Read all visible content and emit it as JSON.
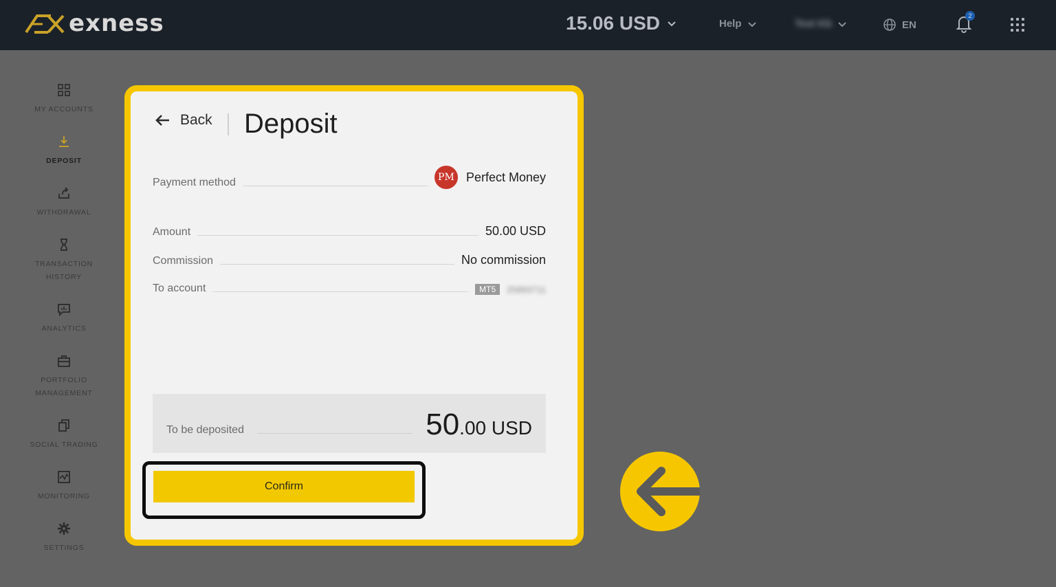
{
  "header": {
    "logo_text": "exness",
    "balance": "15.06 USD",
    "help_label": "Help",
    "user_label": "Test Kb",
    "language": "EN",
    "notification_count": "2"
  },
  "sidebar": {
    "items": [
      {
        "label": "MY ACCOUNTS",
        "icon": "grid-icon"
      },
      {
        "label": "DEPOSIT",
        "icon": "download-icon"
      },
      {
        "label": "WITHDRAWAL",
        "icon": "upload-icon"
      },
      {
        "label": "TRANSACTION HISTORY",
        "icon": "hourglass-icon"
      },
      {
        "label": "ANALYTICS",
        "icon": "chat-chart-icon"
      },
      {
        "label": "PORTFOLIO MANAGEMENT",
        "icon": "briefcase-icon"
      },
      {
        "label": "SOCIAL TRADING",
        "icon": "copy-icon"
      },
      {
        "label": "MONITORING",
        "icon": "monitor-chart-icon"
      },
      {
        "label": "SETTINGS",
        "icon": "gear-icon"
      }
    ]
  },
  "deposit": {
    "back_label": "Back",
    "title": "Deposit",
    "payment_method_label": "Payment method",
    "payment_method_logo": "PM",
    "payment_method_value": "Perfect Money",
    "amount_label": "Amount",
    "amount_value": "50.00 USD",
    "commission_label": "Commission",
    "commission_value": "No commission",
    "to_account_label": "To account",
    "account_type": "MT5",
    "account_number": "25893711",
    "to_be_deposited_label": "To be deposited",
    "deposit_whole": "50",
    "deposit_fraction": ".00 USD",
    "confirm_label": "Confirm"
  },
  "colors": {
    "accent_yellow": "#f6c700",
    "topbar": "#1b2129",
    "backdrop": "#636363"
  }
}
